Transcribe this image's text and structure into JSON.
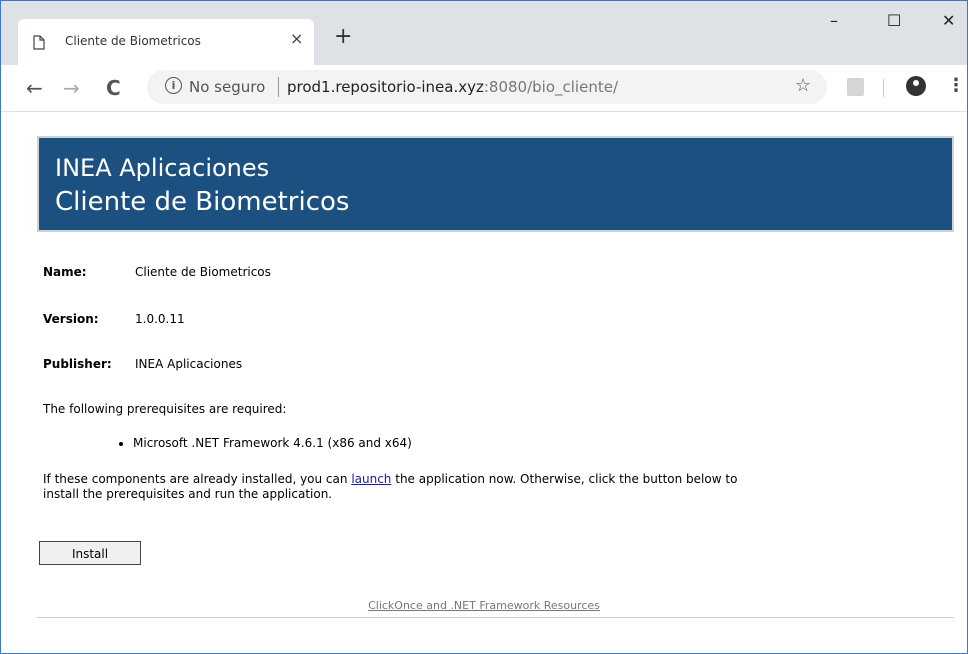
{
  "browser": {
    "tab_title": "Cliente de Biometricos",
    "tab_close": "×",
    "new_tab": "+",
    "window_controls": {
      "minimize": "–",
      "maximize": "☐",
      "close": "✕"
    },
    "nav": {
      "back": "←",
      "forward": "→",
      "reload": "C"
    },
    "security_label": "No seguro",
    "url_host": "prod1.repositorio-inea.xyz",
    "url_rest": ":8080/bio_cliente/",
    "star": "☆",
    "menu": "⋮"
  },
  "page": {
    "banner": {
      "line1": "INEA Aplicaciones",
      "line2": "Cliente de Biometricos",
      "color": "#1b5080"
    },
    "fields": [
      {
        "label": "Name:",
        "value": "Cliente de Biometricos"
      },
      {
        "label": "Version:",
        "value": "1.0.0.11"
      },
      {
        "label": "Publisher:",
        "value": "INEA Aplicaciones"
      }
    ],
    "prereq_intro": "The following prerequisites are required:",
    "prereq_item": "Microsoft .NET Framework 4.6.1 (x86 and x64)",
    "para_before_link": "If these components are already installed, you can ",
    "para_link": "launch",
    "para_after_link": " the application now. Otherwise, click the button below to install the prerequisites and run the application.",
    "install_label": "Install",
    "resources_link": "ClickOnce and .NET Framework Resources"
  }
}
